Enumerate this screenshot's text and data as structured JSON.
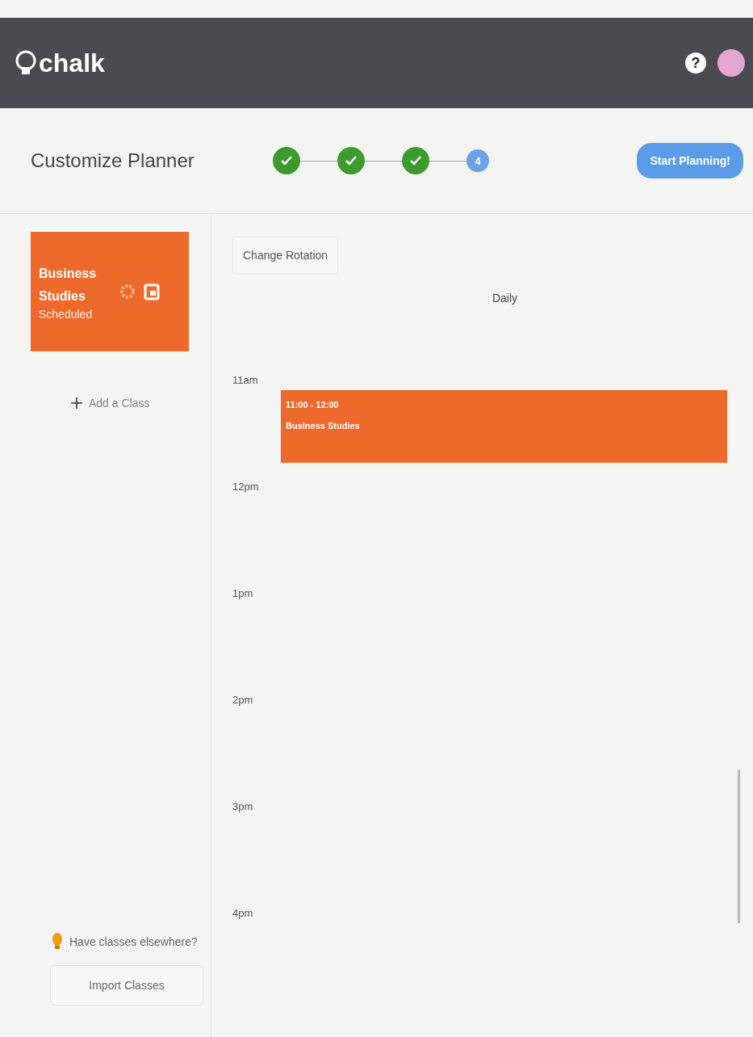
{
  "header": {
    "logo": "chalk",
    "help": "?"
  },
  "toolbar": {
    "title": "Customize Planner",
    "steps": [
      {
        "done": true
      },
      {
        "done": true
      },
      {
        "done": true
      },
      {
        "done": false,
        "number": "4"
      }
    ],
    "action": "Start Planning!"
  },
  "sidebar": {
    "classes": [
      {
        "name": "Business Studies",
        "status": "Scheduled",
        "color": "#ee6a2c"
      }
    ],
    "add": "Add a Class",
    "tip": "Have classes elsewhere?",
    "import": "Import Classes"
  },
  "planner": {
    "rotation_button": "Change Rotation",
    "view": "Daily",
    "hours": [
      "11am",
      "12pm",
      "1pm",
      "2pm",
      "3pm",
      "4pm"
    ],
    "events": [
      {
        "time": "11:00 - 12:00",
        "title": "Business Studies",
        "color": "#ee6a2c"
      }
    ]
  }
}
